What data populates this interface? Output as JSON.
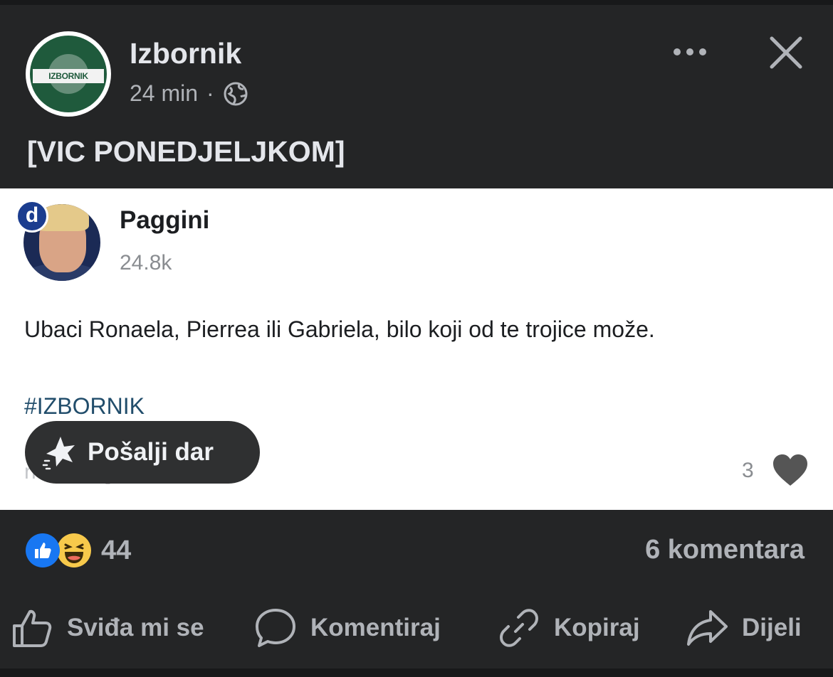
{
  "post": {
    "page_name": "Izbornik",
    "avatar_text": "IZBORNIK",
    "time": "24 min",
    "separator": "·",
    "text": "[VIC PONEDJELJKOM]"
  },
  "embedded_comment": {
    "badge": "d",
    "author": "Paggini",
    "followers": "24.8k",
    "body": "Ubaci Ronaela, Pierrea ili Gabriela, bilo koji od te trojice može.",
    "hashtag": "#IZBORNIK",
    "time": "now",
    "likes": "3"
  },
  "gift": {
    "label": "Pošalji dar"
  },
  "summary": {
    "reaction_count": "44",
    "comments": "6 komentara"
  },
  "actions": {
    "like": "Sviđa mi se",
    "comment": "Komentiraj",
    "copy": "Kopiraj",
    "share": "Dijeli"
  },
  "colors": {
    "background": "#242526",
    "text_primary": "#e4e6eb",
    "text_secondary": "#b0b3b8",
    "brand_green": "#1f5a3c",
    "like_blue": "#1877f2",
    "hashtag": "#214d6b"
  },
  "icons": [
    "globe-icon",
    "more-icon",
    "close-icon",
    "reply-icon",
    "heart-icon",
    "gift-icon",
    "like-icon",
    "comment-icon",
    "link-icon",
    "share-icon"
  ]
}
